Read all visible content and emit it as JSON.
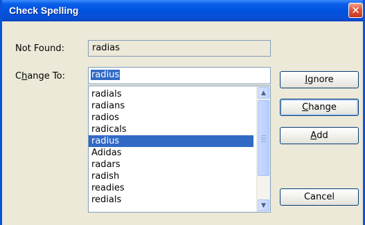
{
  "window": {
    "title": "Check Spelling",
    "close_glyph": "✕"
  },
  "not_found": {
    "label": "Not Found:",
    "value": "radias"
  },
  "change_to": {
    "label_prefix": "C",
    "label_mnemonic": "h",
    "label_suffix": "ange To:",
    "value": "radius"
  },
  "suggestions": {
    "items": [
      "radials",
      "radians",
      "radios",
      "radicals",
      "radius",
      "Adidas",
      "radars",
      "radish",
      "readies",
      "redials"
    ],
    "selected": "radius"
  },
  "buttons": {
    "ignore": {
      "mnemonic": "I",
      "rest": "gnore"
    },
    "change": {
      "mnemonic": "C",
      "rest": "hange"
    },
    "add": {
      "mnemonic": "A",
      "rest": "dd"
    },
    "cancel": {
      "label": "Cancel"
    }
  },
  "colors": {
    "titlebar": "#0052e0",
    "selection": "#316ac5",
    "dialog_bg": "#ece9d8"
  }
}
